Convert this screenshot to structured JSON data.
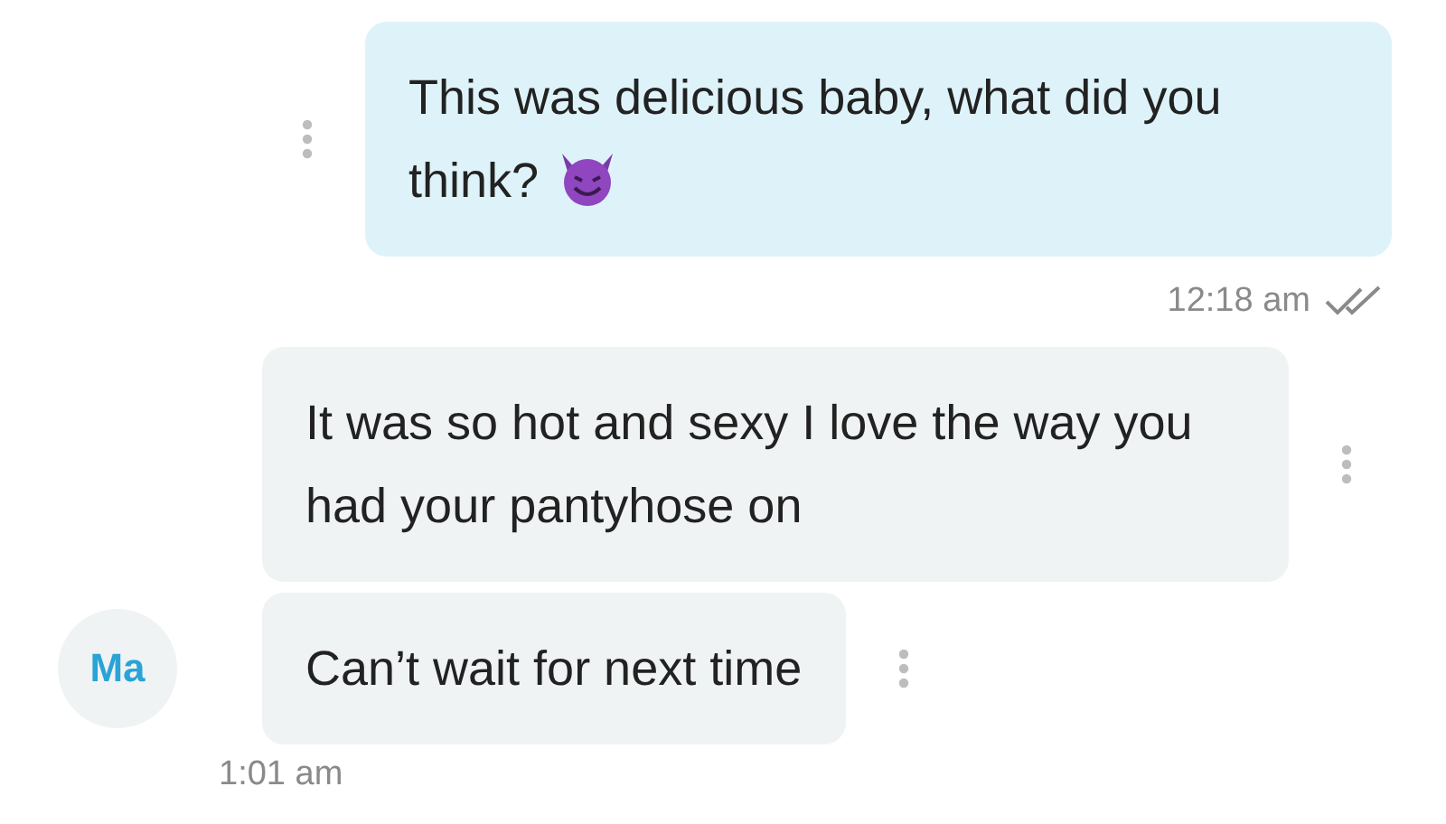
{
  "messages": [
    {
      "kind": "outgoing",
      "text": "This was delicious baby, what did you think?",
      "emoji": true
    },
    {
      "kind": "sent-time",
      "time": "12:18 am",
      "seen": true
    },
    {
      "kind": "incoming",
      "text": "It was so hot and sexy I love the way you had your pantyhose on"
    },
    {
      "kind": "incoming",
      "text": "Can’t wait for next time",
      "initials": "Ma"
    },
    {
      "kind": "received-time",
      "time": "1:01 am"
    }
  ]
}
